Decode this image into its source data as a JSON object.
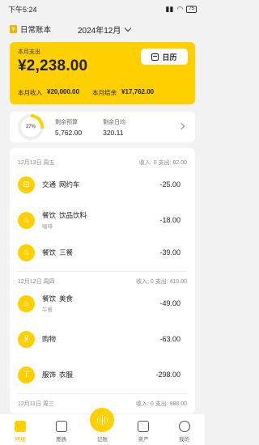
{
  "status": {
    "time": "下午5:24",
    "battery": "75"
  },
  "header": {
    "book_name": "日常账本",
    "month": "2024年12月"
  },
  "summary": {
    "expense_label": "本月支出",
    "expense_amount": "¥2,238.00",
    "calendar_label": "日历",
    "income_label": "本月收入",
    "income_amount": "¥20,000.00",
    "balance_label": "本月结余",
    "balance_amount": "¥17,762.00"
  },
  "budget": {
    "percent_label": "27%",
    "percent_value": 27,
    "remaining_label": "剩余预算",
    "remaining_value": "5,762.00",
    "daily_label": "剩余日均",
    "daily_value": "320.11"
  },
  "days": [
    {
      "date": "12月13日 周五",
      "totals": "收入: 0  支出: 82.00",
      "items": [
        {
          "icon": "transport-icon",
          "glyph": "⊟",
          "category": "交通",
          "sub_category": "网约车",
          "note": "",
          "amount": "-25.00"
        },
        {
          "icon": "food-icon",
          "glyph": "♨",
          "category": "餐饮",
          "sub_category": "饮品饮料",
          "note": "咖啡",
          "amount": "-18.00"
        },
        {
          "icon": "food-icon",
          "glyph": "♨",
          "category": "餐饮",
          "sub_category": "三餐",
          "note": "",
          "amount": "-39.00"
        }
      ]
    },
    {
      "date": "12月12日 周四",
      "totals": "收入: 0  支出: 410.00",
      "items": [
        {
          "icon": "food-icon",
          "glyph": "♨",
          "category": "餐饮",
          "sub_category": "美食",
          "note": "午餐",
          "amount": "-49.00"
        },
        {
          "icon": "shopping-cart-icon",
          "glyph": "⊻",
          "category": "购物",
          "sub_category": "",
          "note": "",
          "amount": "-63.00"
        },
        {
          "icon": "clothing-icon",
          "glyph": "⊤",
          "category": "服饰",
          "sub_category": "衣服",
          "note": "",
          "amount": "-298.00"
        }
      ]
    },
    {
      "date": "12月11日 周三",
      "totals": "收入: 0  支出: 988.00",
      "items": []
    }
  ],
  "nav": {
    "bill": "明细",
    "chart": "图表",
    "record": "记账",
    "assets": "资产",
    "mine": "我的"
  },
  "colors": {
    "accent": "#ffd000",
    "background": "#f2f2f2"
  }
}
